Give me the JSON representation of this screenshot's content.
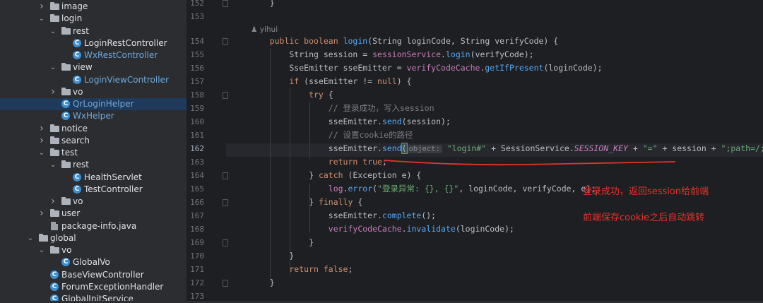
{
  "tree": [
    {
      "label": "image",
      "type": "folder",
      "level": 2,
      "expanded": false
    },
    {
      "label": "login",
      "type": "folder",
      "level": 2,
      "expanded": true
    },
    {
      "label": "rest",
      "type": "folder",
      "level": 3,
      "expanded": true
    },
    {
      "label": "LoginRestController",
      "type": "class",
      "level": 4
    },
    {
      "label": "WxRestController",
      "type": "class",
      "level": 4,
      "color": "blue"
    },
    {
      "label": "view",
      "type": "folder",
      "level": 3,
      "expanded": true
    },
    {
      "label": "LoginViewController",
      "type": "class",
      "level": 4,
      "color": "blue"
    },
    {
      "label": "vo",
      "type": "folder",
      "level": 3,
      "expanded": false
    },
    {
      "label": "QrLoginHelper",
      "type": "class",
      "level": 3,
      "color": "blue",
      "selected": true
    },
    {
      "label": "WxHelper",
      "type": "class",
      "level": 3,
      "color": "blue"
    },
    {
      "label": "notice",
      "type": "folder",
      "level": 2,
      "expanded": false
    },
    {
      "label": "search",
      "type": "folder",
      "level": 2,
      "expanded": false
    },
    {
      "label": "test",
      "type": "folder",
      "level": 2,
      "expanded": true
    },
    {
      "label": "rest",
      "type": "folder",
      "level": 3,
      "expanded": true
    },
    {
      "label": "HealthServlet",
      "type": "class",
      "level": 4
    },
    {
      "label": "TestController",
      "type": "class",
      "level": 4
    },
    {
      "label": "vo",
      "type": "folder",
      "level": 3,
      "expanded": false
    },
    {
      "label": "user",
      "type": "folder",
      "level": 2,
      "expanded": false
    },
    {
      "label": "package-info.java",
      "type": "file",
      "level": 2
    },
    {
      "label": "global",
      "type": "folder",
      "level": 1,
      "expanded": true
    },
    {
      "label": "vo",
      "type": "folder",
      "level": 2,
      "expanded": true
    },
    {
      "label": "GlobalVo",
      "type": "class",
      "level": 3
    },
    {
      "label": "BaseViewController",
      "type": "class",
      "level": 2
    },
    {
      "label": "ForumExceptionHandler",
      "type": "class",
      "level": 2
    },
    {
      "label": "GlobalInitService",
      "type": "class",
      "level": 2
    }
  ],
  "editor": {
    "author": "yihui",
    "line_numbers": [
      "152",
      "153",
      "154",
      "155",
      "156",
      "157",
      "158",
      "159",
      "160",
      "161",
      "162",
      "163",
      "164",
      "165",
      "166",
      "167",
      "168",
      "169",
      "170",
      "171",
      "172",
      "173"
    ],
    "current_line": "162",
    "code": [
      {
        "ln": "152",
        "indent": 0,
        "tokens": [
          [
            "p",
            "    }"
          ]
        ]
      },
      {
        "ln": "153",
        "indent": 0,
        "tokens": []
      },
      {
        "ln": "154",
        "indent": 0,
        "tokens": [
          [
            "kw",
            "    public boolean "
          ],
          [
            "fn",
            "login"
          ],
          [
            "p",
            "(String loginCode, String verifyCode) {"
          ]
        ]
      },
      {
        "ln": "155",
        "indent": 0,
        "tokens": [
          [
            "p",
            "        String session = "
          ],
          [
            "fld",
            "sessionService"
          ],
          [
            "p",
            "."
          ],
          [
            "fn",
            "login"
          ],
          [
            "p",
            "(verifyCode);"
          ]
        ]
      },
      {
        "ln": "156",
        "indent": 0,
        "tokens": [
          [
            "p",
            "        SseEmitter sseEmitter = "
          ],
          [
            "fld",
            "verifyCodeCache"
          ],
          [
            "p",
            "."
          ],
          [
            "fn",
            "getIfPresent"
          ],
          [
            "p",
            "(loginCode);"
          ]
        ]
      },
      {
        "ln": "157",
        "indent": 0,
        "tokens": [
          [
            "kw",
            "        if "
          ],
          [
            "p",
            "(sseEmitter != "
          ],
          [
            "kw",
            "null"
          ],
          [
            "p",
            ") {"
          ]
        ]
      },
      {
        "ln": "158",
        "indent": 0,
        "tokens": [
          [
            "kw",
            "            try "
          ],
          [
            "p",
            "{"
          ]
        ]
      },
      {
        "ln": "159",
        "indent": 0,
        "tokens": [
          [
            "cmt",
            "                // 登录成功，写入session"
          ]
        ]
      },
      {
        "ln": "160",
        "indent": 0,
        "tokens": [
          [
            "p",
            "                sseEmitter."
          ],
          [
            "fn",
            "send"
          ],
          [
            "p",
            "(session);"
          ]
        ]
      },
      {
        "ln": "161",
        "indent": 0,
        "tokens": [
          [
            "cmt",
            "                // 设置cookie的路径"
          ]
        ]
      },
      {
        "ln": "162",
        "indent": 0,
        "tokens": [
          [
            "p",
            "                sseEmitter."
          ],
          [
            "fn",
            "send"
          ],
          [
            "br",
            "("
          ],
          [
            "hint",
            "object:"
          ],
          [
            "str",
            " \"login#\""
          ],
          [
            "p",
            " + SessionService."
          ],
          [
            "cst",
            "SESSION_KEY"
          ],
          [
            "p",
            " + "
          ],
          [
            "str",
            "\"=\""
          ],
          [
            "p",
            " + session + "
          ],
          [
            "str",
            "\";path=/;\""
          ],
          [
            "br",
            ")"
          ],
          [
            "p",
            ";"
          ]
        ]
      },
      {
        "ln": "163",
        "indent": 0,
        "tokens": [
          [
            "kw",
            "                return true"
          ],
          [
            "p",
            ";"
          ]
        ]
      },
      {
        "ln": "164",
        "indent": 0,
        "tokens": [
          [
            "p",
            "            } "
          ],
          [
            "kw",
            "catch "
          ],
          [
            "p",
            "(Exception e) {"
          ]
        ]
      },
      {
        "ln": "165",
        "indent": 0,
        "tokens": [
          [
            "fld",
            "                log"
          ],
          [
            "p",
            "."
          ],
          [
            "fn",
            "error"
          ],
          [
            "p",
            "("
          ],
          [
            "str",
            "\"登录异常: {}, {}\""
          ],
          [
            "p",
            ", loginCode, verifyCode, e);"
          ]
        ]
      },
      {
        "ln": "166",
        "indent": 0,
        "tokens": [
          [
            "p",
            "            } "
          ],
          [
            "kw",
            "finally "
          ],
          [
            "p",
            "{"
          ]
        ]
      },
      {
        "ln": "167",
        "indent": 0,
        "tokens": [
          [
            "p",
            "                sseEmitter."
          ],
          [
            "fn",
            "complete"
          ],
          [
            "p",
            "();"
          ]
        ]
      },
      {
        "ln": "168",
        "indent": 0,
        "tokens": [
          [
            "fld",
            "                verifyCodeCache"
          ],
          [
            "p",
            "."
          ],
          [
            "fn",
            "invalidate"
          ],
          [
            "p",
            "(loginCode);"
          ]
        ]
      },
      {
        "ln": "169",
        "indent": 0,
        "tokens": [
          [
            "p",
            "            }"
          ]
        ]
      },
      {
        "ln": "170",
        "indent": 0,
        "tokens": [
          [
            "p",
            "        }"
          ]
        ]
      },
      {
        "ln": "171",
        "indent": 0,
        "tokens": [
          [
            "kw",
            "        return false"
          ],
          [
            "p",
            ";"
          ]
        ]
      },
      {
        "ln": "172",
        "indent": 0,
        "tokens": [
          [
            "p",
            "    }"
          ]
        ]
      },
      {
        "ln": "173",
        "indent": 0,
        "tokens": []
      }
    ]
  },
  "annotations": {
    "note1": "登录成功，返回session给前端",
    "note2": "前端保存cookie之后自动跳转",
    "color": "#e8322c"
  },
  "icons": {
    "folder": "folder-icon",
    "class": "java-class-icon",
    "file": "java-file-icon",
    "chevron_right": "chevron-right-icon",
    "chevron_down": "chevron-down-icon",
    "author": "user-icon"
  }
}
